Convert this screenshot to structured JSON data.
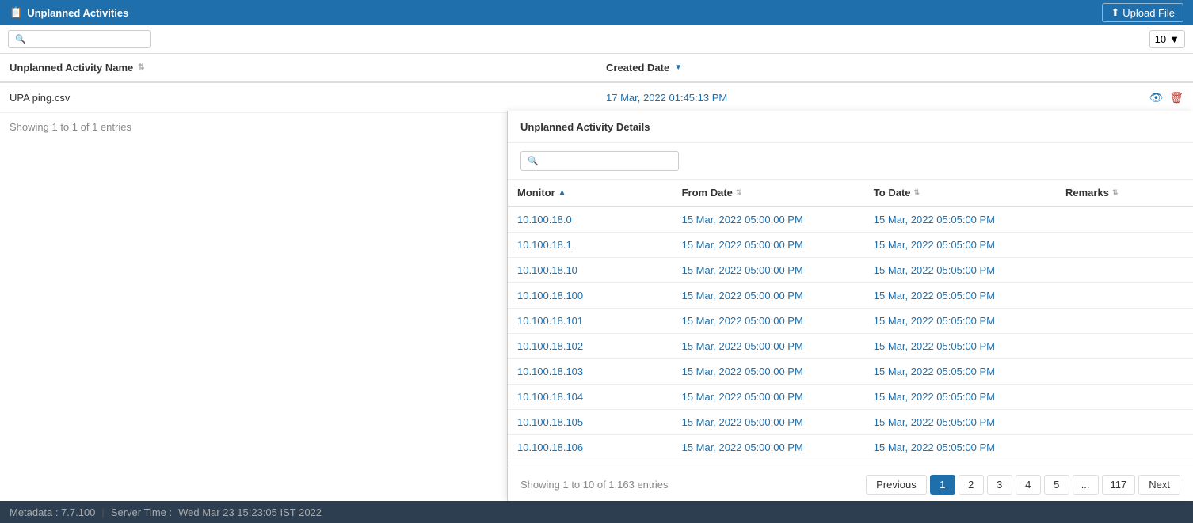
{
  "header": {
    "title": "Unplanned Activities",
    "upload_label": "Upload File",
    "upload_icon": "⬆"
  },
  "toolbar": {
    "search_placeholder": "",
    "per_page_value": "10",
    "per_page_icon": "▼"
  },
  "main_table": {
    "columns": [
      {
        "label": "Unplanned Activity Name",
        "sort": "neutral"
      },
      {
        "label": "Created Date",
        "sort": "desc"
      }
    ],
    "rows": [
      {
        "name": "UPA ping.csv",
        "date": "17 Mar, 2022 01:45:13 PM"
      }
    ],
    "info": "Showing 1 to 1 of 1 entries"
  },
  "details_panel": {
    "title": "Unplanned Activity Details",
    "search_placeholder": "",
    "columns": [
      {
        "label": "Monitor",
        "sort": "asc"
      },
      {
        "label": "From Date",
        "sort": "neutral"
      },
      {
        "label": "To Date",
        "sort": "neutral"
      },
      {
        "label": "Remarks",
        "sort": "neutral"
      }
    ],
    "rows": [
      {
        "monitor": "10.100.18.0",
        "from": "15 Mar, 2022 05:00:00 PM",
        "to": "15 Mar, 2022 05:05:00 PM",
        "remarks": ""
      },
      {
        "monitor": "10.100.18.1",
        "from": "15 Mar, 2022 05:00:00 PM",
        "to": "15 Mar, 2022 05:05:00 PM",
        "remarks": ""
      },
      {
        "monitor": "10.100.18.10",
        "from": "15 Mar, 2022 05:00:00 PM",
        "to": "15 Mar, 2022 05:05:00 PM",
        "remarks": ""
      },
      {
        "monitor": "10.100.18.100",
        "from": "15 Mar, 2022 05:00:00 PM",
        "to": "15 Mar, 2022 05:05:00 PM",
        "remarks": ""
      },
      {
        "monitor": "10.100.18.101",
        "from": "15 Mar, 2022 05:00:00 PM",
        "to": "15 Mar, 2022 05:05:00 PM",
        "remarks": ""
      },
      {
        "monitor": "10.100.18.102",
        "from": "15 Mar, 2022 05:00:00 PM",
        "to": "15 Mar, 2022 05:05:00 PM",
        "remarks": ""
      },
      {
        "monitor": "10.100.18.103",
        "from": "15 Mar, 2022 05:00:00 PM",
        "to": "15 Mar, 2022 05:05:00 PM",
        "remarks": ""
      },
      {
        "monitor": "10.100.18.104",
        "from": "15 Mar, 2022 05:00:00 PM",
        "to": "15 Mar, 2022 05:05:00 PM",
        "remarks": ""
      },
      {
        "monitor": "10.100.18.105",
        "from": "15 Mar, 2022 05:00:00 PM",
        "to": "15 Mar, 2022 05:05:00 PM",
        "remarks": ""
      },
      {
        "monitor": "10.100.18.106",
        "from": "15 Mar, 2022 05:00:00 PM",
        "to": "15 Mar, 2022 05:05:00 PM",
        "remarks": ""
      }
    ],
    "footer_info": "Showing 1 to 10 of 1,163 entries",
    "pagination": {
      "previous": "Previous",
      "pages": [
        "1",
        "2",
        "3",
        "4",
        "5",
        "...",
        "117"
      ],
      "next": "Next",
      "active_page": "1"
    }
  },
  "footer": {
    "metadata": "Metadata : 7.7.100",
    "divider": "|",
    "server_time_label": "Server Time :",
    "server_time": "Wed Mar 23 15:23:05 IST 2022"
  }
}
